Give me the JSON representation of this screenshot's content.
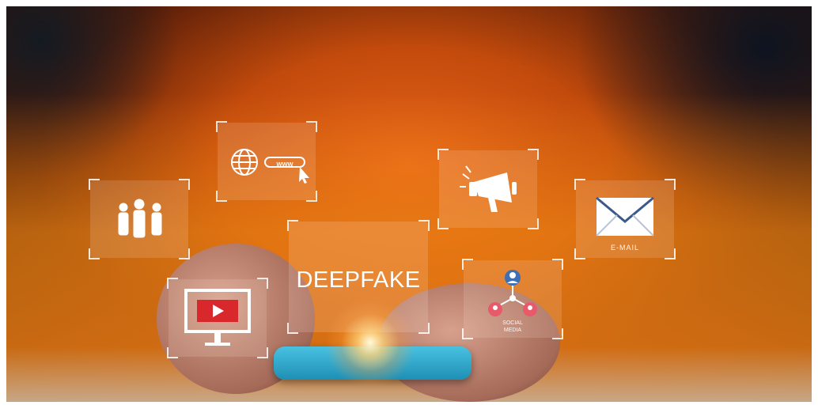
{
  "image": {
    "subject": "person-with-smartphone-and-floating-icons",
    "palette": {
      "sweater": "#e8761a",
      "background": "#141a22",
      "phone": "#2fa9cf",
      "glow": "#fff3c8"
    }
  },
  "panels": {
    "deepfake": {
      "text": "DEEPFAKE"
    },
    "www": {
      "text": "www",
      "icon": "globe-icon"
    },
    "email": {
      "text": "E-MAIL",
      "icon": "envelope-icon"
    },
    "social": {
      "text_line1": "SOCIAL",
      "text_line2": "MEDIA",
      "icon": "network-icon"
    },
    "people": {
      "icon": "people-icon"
    },
    "megaphone": {
      "icon": "megaphone-icon"
    },
    "video": {
      "icon": "video-monitor-icon"
    }
  }
}
